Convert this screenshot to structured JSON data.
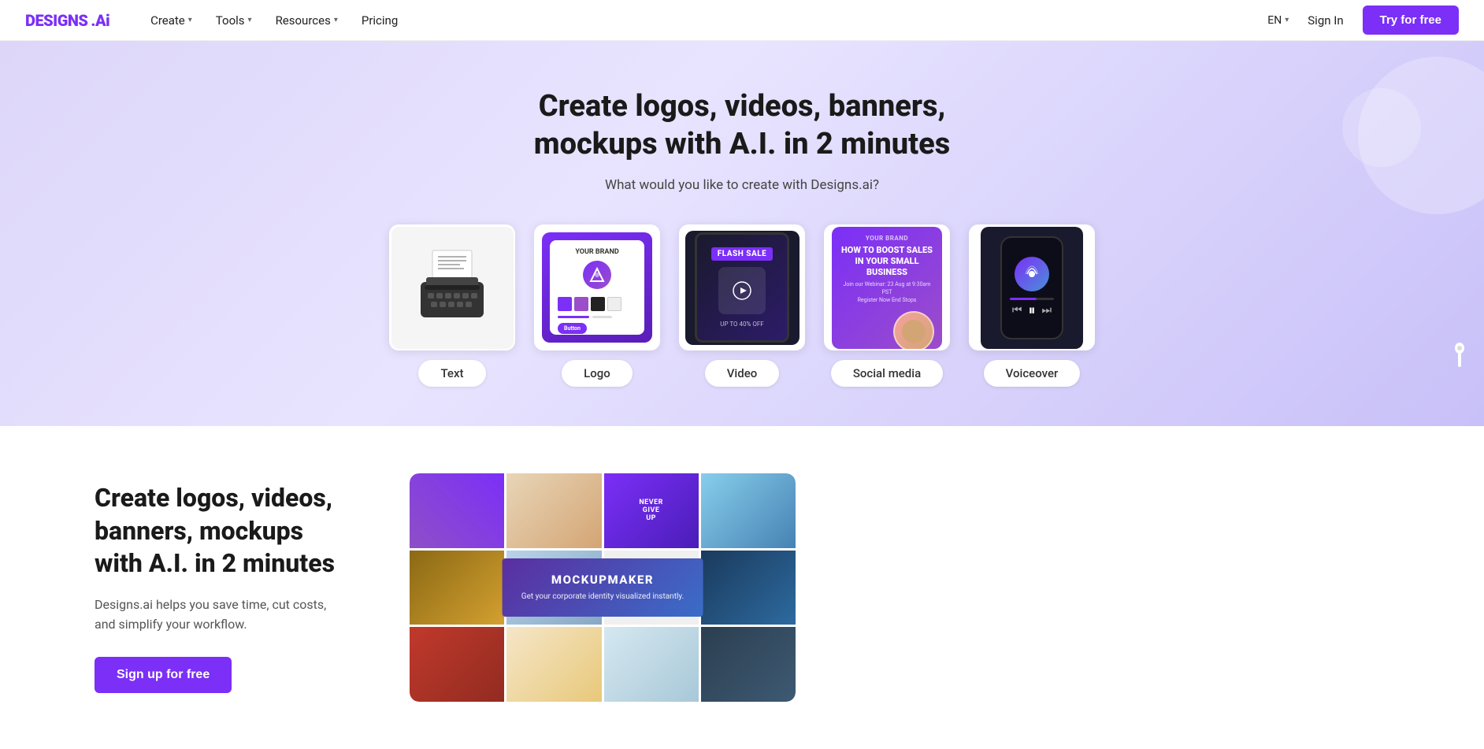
{
  "brand": {
    "name": "DESIGNS",
    "suffix": ".Ai"
  },
  "navbar": {
    "items": [
      {
        "label": "Create",
        "hasDropdown": true
      },
      {
        "label": "Tools",
        "hasDropdown": true
      },
      {
        "label": "Resources",
        "hasDropdown": true
      },
      {
        "label": "Pricing",
        "hasDropdown": false
      }
    ],
    "lang": "EN",
    "signIn": "Sign In",
    "tryFree": "Try for free"
  },
  "hero": {
    "title": "Create logos, videos, banners, mockups with A.I. in 2 minutes",
    "subtitle": "What would you like to create with Designs.ai?",
    "cards": [
      {
        "id": "text",
        "label": "Text"
      },
      {
        "id": "logo",
        "label": "Logo"
      },
      {
        "id": "video",
        "label": "Video"
      },
      {
        "id": "social",
        "label": "Social media"
      },
      {
        "id": "voiceover",
        "label": "Voiceover"
      }
    ]
  },
  "features": {
    "title": "Create logos, videos, banners, mockups with A.I. in 2 minutes",
    "description": "Designs.ai helps you save time, cut costs, and simplify your workflow.",
    "cta": "Sign up for free",
    "mockup": {
      "overlayTitle": "MOCKUPMAKER",
      "overlaySubtitle": "Get your corporate identity visualized instantly."
    }
  }
}
